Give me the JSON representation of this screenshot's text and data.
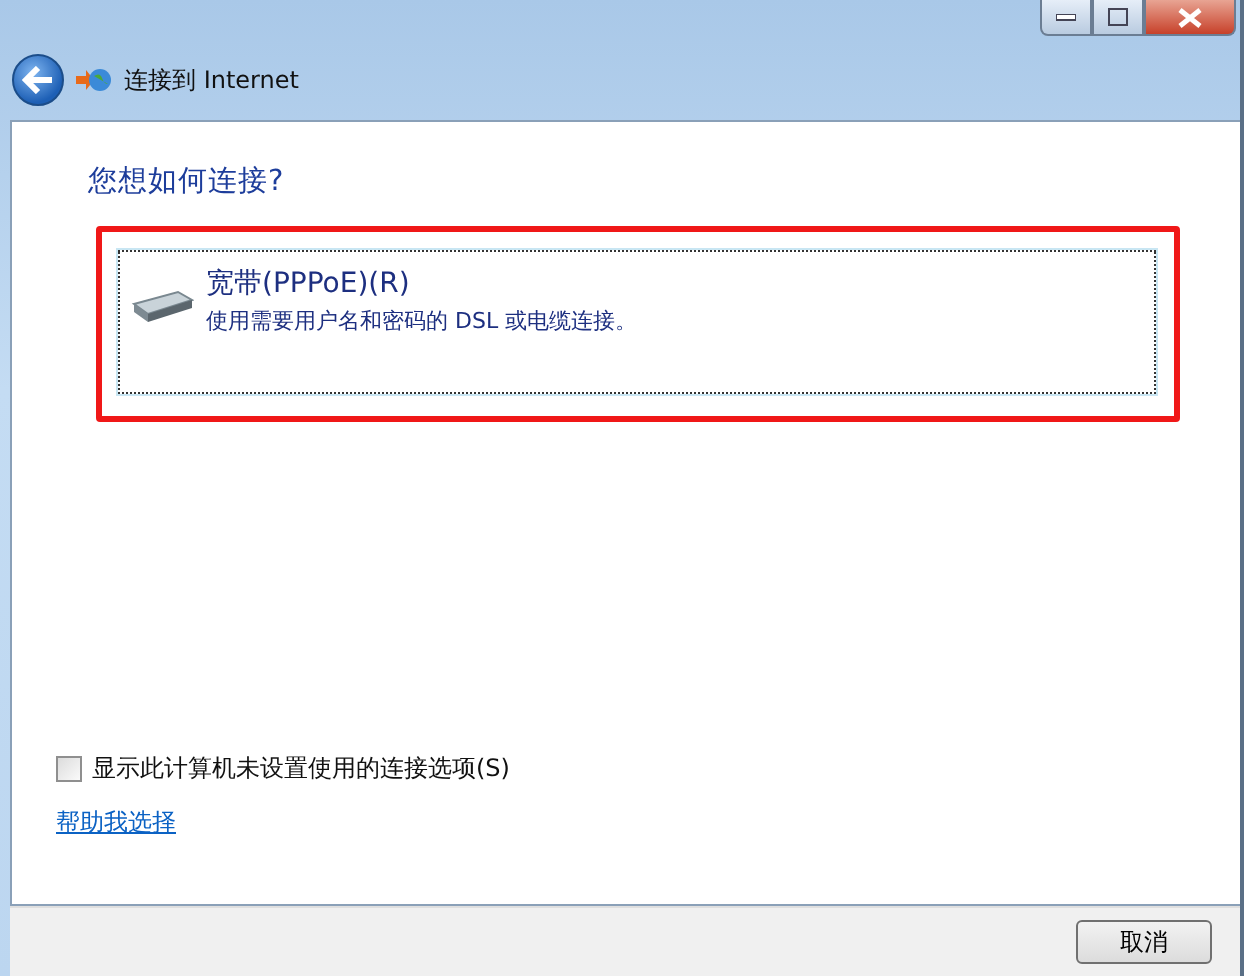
{
  "window": {
    "title": "连接到 Internet"
  },
  "heading": "您想如何连接?",
  "options": [
    {
      "title": "宽带(PPPoE)(R)",
      "description": "使用需要用户名和密码的 DSL 或电缆连接。",
      "selected": true,
      "highlighted": true
    }
  ],
  "show_unset_options": {
    "label": "显示此计算机未设置使用的连接选项(S)",
    "checked": false
  },
  "help_link": "帮助我选择",
  "buttons": [
    "取消"
  ]
}
